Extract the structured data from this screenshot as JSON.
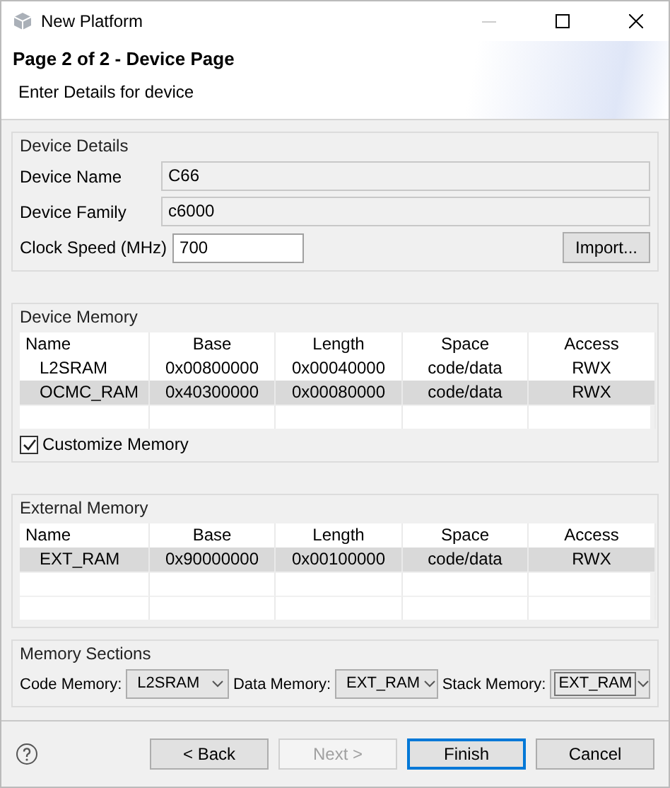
{
  "window": {
    "title": "New Platform"
  },
  "header": {
    "title": "Page 2 of 2 - Device Page",
    "subtitle": "Enter Details for device"
  },
  "device_details": {
    "title": "Device Details",
    "fields": [
      {
        "label": "Device Name",
        "value": "C66",
        "disabled": true
      },
      {
        "label": "Device Family",
        "value": "c6000",
        "disabled": true
      }
    ],
    "clock": {
      "label": "Clock Speed (MHz)",
      "value": "700"
    },
    "import_button": "Import..."
  },
  "device_memory": {
    "title": "Device Memory",
    "columns": [
      "Name",
      "Base",
      "Length",
      "Space",
      "Access"
    ],
    "rows": [
      {
        "cells": [
          "L2SRAM",
          "0x00800000",
          "0x00040000",
          "code/data",
          "RWX"
        ],
        "selected": false
      },
      {
        "cells": [
          "OCMC_RAM",
          "0x40300000",
          "0x00080000",
          "code/data",
          "RWX"
        ],
        "selected": true
      }
    ],
    "customize": {
      "label": "Customize Memory",
      "checked": true
    }
  },
  "external_memory": {
    "title": "External Memory",
    "columns": [
      "Name",
      "Base",
      "Length",
      "Space",
      "Access"
    ],
    "rows": [
      {
        "cells": [
          "EXT_RAM",
          "0x90000000",
          "0x00100000",
          "code/data",
          "RWX"
        ],
        "selected": true
      }
    ]
  },
  "memory_sections": {
    "title": "Memory Sections",
    "selects": [
      {
        "label": "Code Memory:",
        "value": "L2SRAM",
        "focused": false
      },
      {
        "label": "Data Memory:",
        "value": "EXT_RAM",
        "focused": false
      },
      {
        "label": "Stack Memory:",
        "value": "EXT_RAM",
        "focused": true
      }
    ]
  },
  "buttons": [
    {
      "label": "< Back",
      "disabled": false,
      "default": false
    },
    {
      "label": "Next >",
      "disabled": true,
      "default": false
    },
    {
      "label": "Finish",
      "disabled": false,
      "default": true
    },
    {
      "label": "Cancel",
      "disabled": false,
      "default": false
    }
  ]
}
